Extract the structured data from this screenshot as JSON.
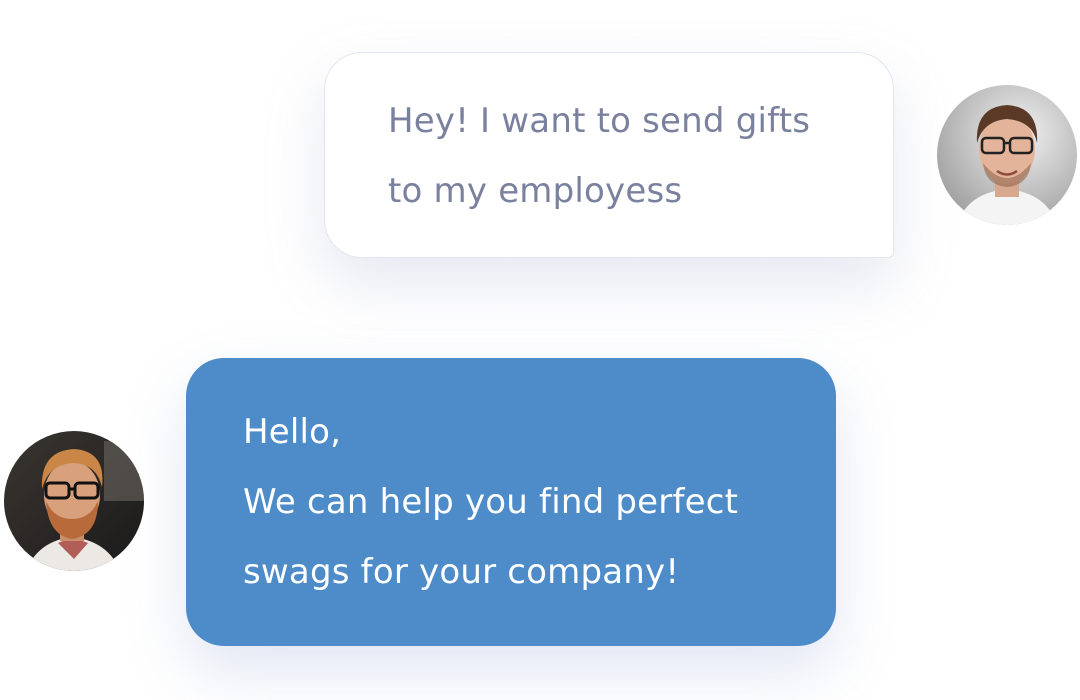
{
  "conversation": {
    "messages": [
      {
        "sender": "user",
        "lines": [
          "Hey! I want to send gifts",
          "to my employess"
        ],
        "bubble_color": "#ffffff",
        "text_color": "#7a819e"
      },
      {
        "sender": "agent",
        "lines": [
          "Hello,",
          "We can help you find perfect",
          "swags for your company!"
        ],
        "bubble_color": "#4d8bc9",
        "text_color": "#ffffff"
      }
    ],
    "avatars": {
      "user": "customer-avatar-icon",
      "agent": "agent-avatar-icon"
    }
  }
}
